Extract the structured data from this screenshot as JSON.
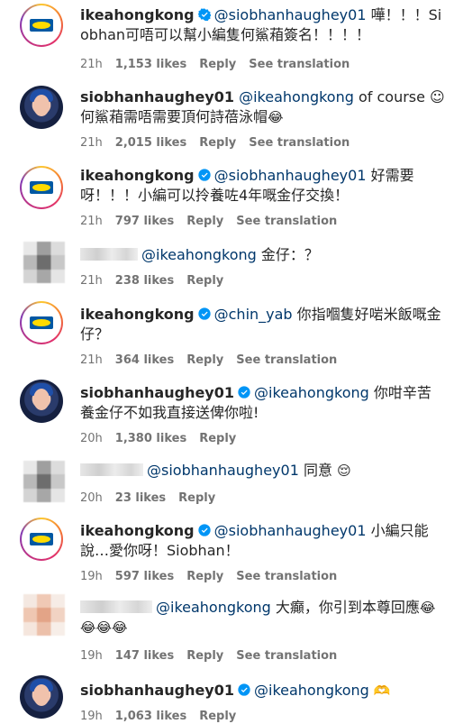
{
  "comments": [
    {
      "user": "ikeahongkong",
      "verified": true,
      "avatar": "ikea",
      "mention": "@siobhanhaughey01",
      "text": " 嘩！！！Siobhan可唔可以幫小編隻何鯊葙簽名！！！！",
      "time": "21h",
      "likes": "1,153 likes",
      "reply": "Reply",
      "translate": "See translation"
    },
    {
      "user": "siobhanhaughey01",
      "verified": false,
      "avatar": "sio",
      "mention": "@ikeahongkong",
      "text": " of course ☺何鯊葙需唔需要頂何詩蓓泳帽",
      "emoji": "😂",
      "time": "21h",
      "likes": "2,015 likes",
      "reply": "Reply",
      "translate": "See translation"
    },
    {
      "user": "ikeahongkong",
      "verified": true,
      "avatar": "ikea",
      "mention": "@siobhanhaughey01",
      "text": " 好需要呀！！！小編可以拎養咗4年嘅金仔交換！",
      "time": "21h",
      "likes": "797 likes",
      "reply": "Reply",
      "translate": "See translation"
    },
    {
      "user": "",
      "verified": false,
      "avatar": "blur",
      "mention": "@ikeahongkong",
      "text": " 金仔：？",
      "time": "21h",
      "likes": "238 likes",
      "reply": "Reply",
      "translate": ""
    },
    {
      "user": "ikeahongkong",
      "verified": true,
      "avatar": "ikea",
      "mention": "@chin_yab",
      "text": " 你指嗰隻好啱米飯嘅金仔？",
      "time": "21h",
      "likes": "364 likes",
      "reply": "Reply",
      "translate": "See translation"
    },
    {
      "user": "siobhanhaughey01",
      "verified": true,
      "avatar": "sio",
      "mention": "@ikeahongkong",
      "text": " 你咁辛苦養金仔不如我直接送俾你啦!",
      "time": "20h",
      "likes": "1,380 likes",
      "reply": "Reply",
      "translate": ""
    },
    {
      "user": "",
      "verified": false,
      "avatar": "blur",
      "mention": "@siobhanhaughey01",
      "text": " 同意",
      "emoji": "😌",
      "time": "20h",
      "likes": "23 likes",
      "reply": "Reply",
      "translate": ""
    },
    {
      "user": "ikeahongkong",
      "verified": true,
      "avatar": "ikea",
      "mention": "@siobhanhaughey01",
      "text": " 小編只能說…愛你呀！Siobhan！",
      "time": "19h",
      "likes": "597 likes",
      "reply": "Reply",
      "translate": "See translation"
    },
    {
      "user": "",
      "verified": false,
      "avatar": "blur-warm",
      "mention": "@ikeahongkong",
      "text": " 大癲，你引到本尊回應",
      "emoji": "😂😂😂😂",
      "time": "19h",
      "likes": "147 likes",
      "reply": "Reply",
      "translate": "See translation"
    },
    {
      "user": "siobhanhaughey01",
      "verified": true,
      "avatar": "sio",
      "mention": "@ikeahongkong",
      "text": " ",
      "emoji": "🫶",
      "time": "19h",
      "likes": "1,063 likes",
      "reply": "Reply",
      "translate": ""
    }
  ],
  "colors": {
    "verified": "#0095f6",
    "mention": "#00376b",
    "meta": "#737373"
  }
}
